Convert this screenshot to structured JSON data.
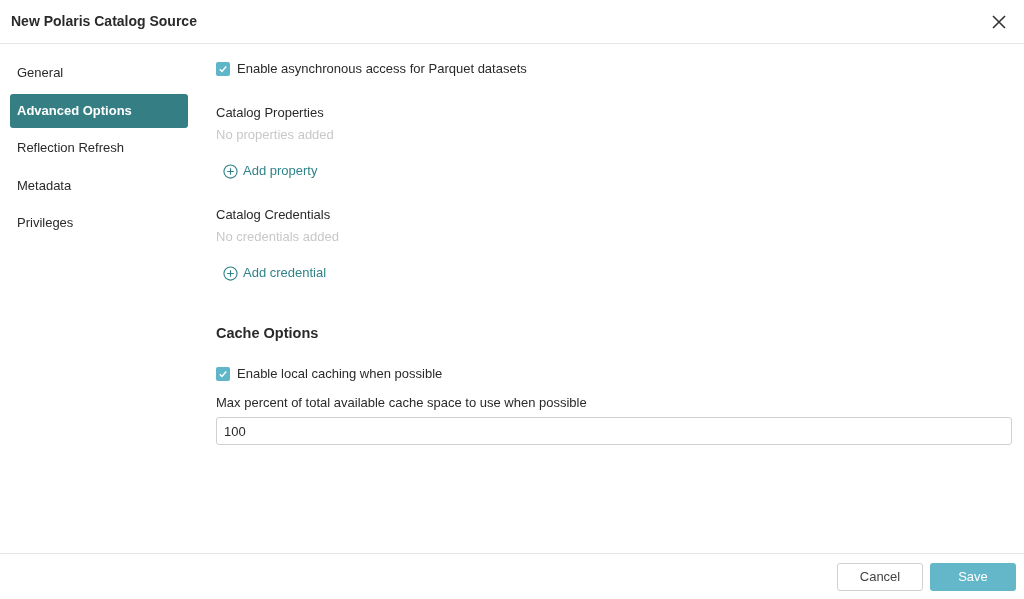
{
  "dialog": {
    "title": "New Polaris Catalog Source"
  },
  "sidebar": {
    "items": [
      {
        "label": "General",
        "selected": false
      },
      {
        "label": "Advanced Options",
        "selected": true
      },
      {
        "label": "Reflection Refresh",
        "selected": false
      },
      {
        "label": "Metadata",
        "selected": false
      },
      {
        "label": "Privileges",
        "selected": false
      }
    ]
  },
  "content": [
    {
      "kind": "checkbox",
      "label": "Enable asynchronous access for Parquet datasets",
      "checked": true
    },
    {
      "kind": "list",
      "label": "Catalog Properties",
      "empty_text": "No properties added",
      "add_label": "Add property"
    },
    {
      "kind": "list",
      "label": "Catalog Credentials",
      "empty_text": "No credentials added",
      "add_label": "Add credential"
    },
    {
      "kind": "heading",
      "label": "Cache Options"
    },
    {
      "kind": "checkbox",
      "label": "Enable local caching when possible",
      "checked": true
    },
    {
      "kind": "field",
      "label": "Max percent of total available cache space to use when possible",
      "value": "100"
    }
  ],
  "buttons": [
    {
      "label": "Cancel",
      "kind": "secondary"
    },
    {
      "label": "Save",
      "kind": "primary"
    }
  ]
}
